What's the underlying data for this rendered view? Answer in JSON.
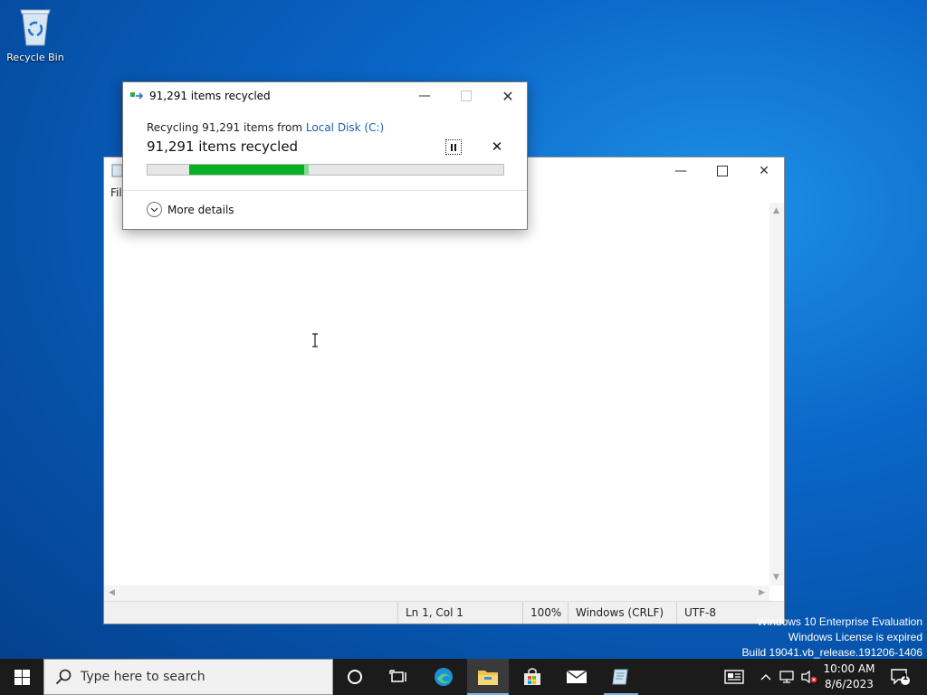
{
  "desktop": {
    "recycle_bin_label": "Recycle Bin"
  },
  "notepad": {
    "menu_partial": "Fil",
    "status": {
      "position": "Ln 1, Col 1",
      "zoom": "100%",
      "line_ending": "Windows (CRLF)",
      "encoding": "UTF-8"
    }
  },
  "dialog": {
    "title": "91,291 items recycled",
    "subtitle_prefix": "Recycling 91,291 items from ",
    "source_link": "Local Disk (C:)",
    "status_text": "91,291 items recycled",
    "progress_percent": 44,
    "more_details_label": "More details"
  },
  "watermark": {
    "line1": "Windows 10 Enterprise Evaluation",
    "line2": "Windows License is expired",
    "line3": "Build 19041.vb_release.191206-1406"
  },
  "taskbar": {
    "search_placeholder": "Type here to search",
    "clock_time": "10:00 AM",
    "clock_date": "8/6/2023",
    "notification_count": "1"
  },
  "colors": {
    "progress_fill": "#06b025",
    "link": "#1a5fb4",
    "taskbar": "#1b1b1b"
  }
}
